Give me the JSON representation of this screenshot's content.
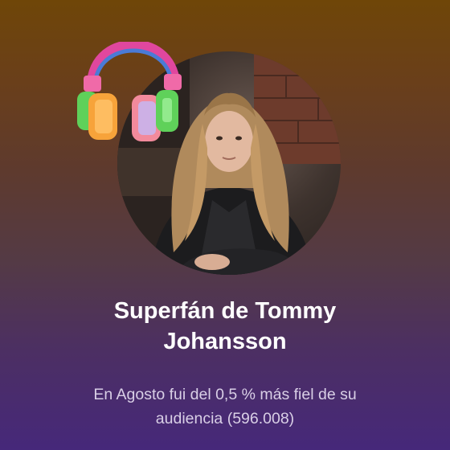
{
  "card": {
    "title_line1": "Superfán de Tommy",
    "title_line2": "Johansson",
    "description_line1": "En Agosto fui del 0,5 % más fiel de su",
    "description_line2": "audiencia (596.008)"
  },
  "icons": {
    "avatar": "artist-photo",
    "badge": "headphones-icon"
  },
  "colors": {
    "gradient_top": "#6f4608",
    "gradient_bottom": "#46287a",
    "title": "#ffffff",
    "description": "#d9cfe6",
    "headphone_band": "#e0479e",
    "headphone_cup_left": "#f7a33a",
    "headphone_cup_right": "#5fd15a"
  }
}
